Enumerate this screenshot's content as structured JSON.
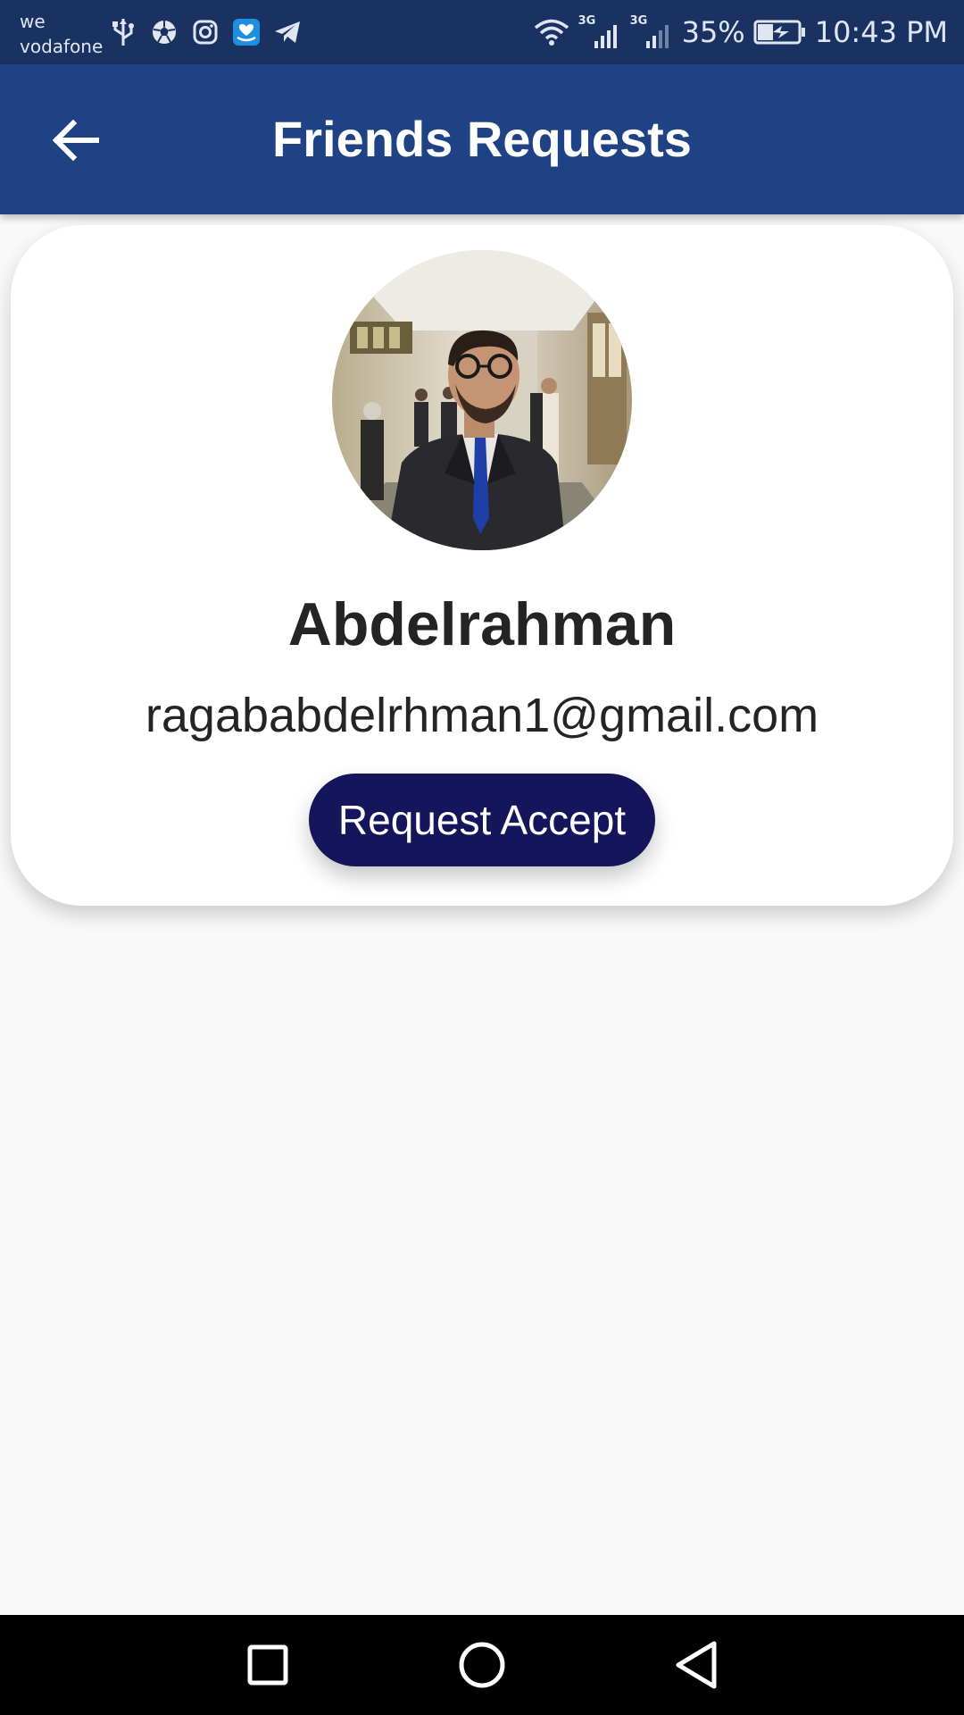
{
  "status_bar": {
    "carrier_line1": "we",
    "carrier_line2": "vodafone",
    "left_icons": [
      "usb-icon",
      "soccer-ball-icon",
      "instagram-icon",
      "messaging-app-icon",
      "telegram-icon"
    ],
    "network_label_1": "3G",
    "network_label_2": "3G",
    "battery_percent": "35%",
    "time": "10:43 PM"
  },
  "app_bar": {
    "title": "Friends Requests",
    "back_icon": "arrow-back-icon"
  },
  "friend_request": {
    "name": "Abdelrahman",
    "email": "ragababdelrhman1@gmail.com",
    "accept_label": "Request Accept"
  },
  "nav_bar": {
    "icons": [
      "recents-square-icon",
      "home-circle-icon",
      "back-triangle-icon"
    ]
  },
  "colors": {
    "status_bar_bg": "#1a3261",
    "app_bar_bg": "#1f4285",
    "button_bg": "#15155c",
    "page_bg": "#f9f9f9"
  }
}
